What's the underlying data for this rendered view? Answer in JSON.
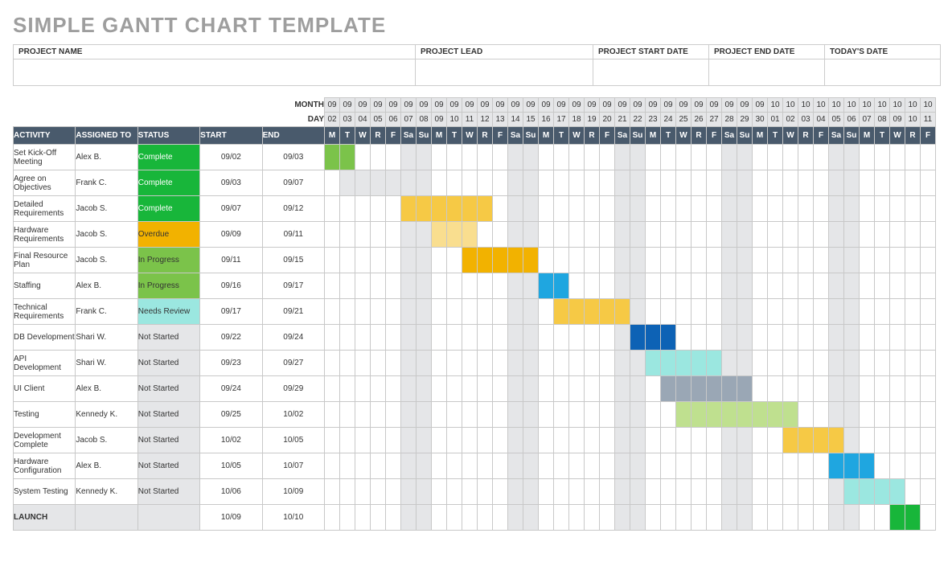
{
  "title": "SIMPLE GANTT CHART TEMPLATE",
  "meta": {
    "projectName": {
      "label": "PROJECT NAME",
      "value": ""
    },
    "projectLead": {
      "label": "PROJECT LEAD",
      "value": ""
    },
    "startDate": {
      "label": "PROJECT START DATE",
      "value": ""
    },
    "endDate": {
      "label": "PROJECT END DATE",
      "value": ""
    },
    "todaysDate": {
      "label": "TODAY'S DATE",
      "value": ""
    }
  },
  "rowLabels": {
    "month": "MONTH",
    "day": "DAY"
  },
  "columnHeaders": {
    "activity": "ACTIVITY",
    "assigned": "ASSIGNED TO",
    "status": "STATUS",
    "start": "START",
    "end": "END"
  },
  "calendar": {
    "months": [
      "09",
      "09",
      "09",
      "09",
      "09",
      "09",
      "09",
      "09",
      "09",
      "09",
      "09",
      "09",
      "09",
      "09",
      "09",
      "09",
      "09",
      "09",
      "09",
      "09",
      "09",
      "09",
      "09",
      "09",
      "09",
      "09",
      "09",
      "09",
      "09",
      "10",
      "10",
      "10",
      "10",
      "10",
      "10",
      "10",
      "10",
      "10",
      "10",
      "10"
    ],
    "days": [
      "02",
      "03",
      "04",
      "05",
      "06",
      "07",
      "08",
      "09",
      "10",
      "11",
      "12",
      "13",
      "14",
      "15",
      "16",
      "17",
      "18",
      "19",
      "20",
      "21",
      "22",
      "23",
      "24",
      "25",
      "26",
      "27",
      "28",
      "29",
      "30",
      "01",
      "02",
      "03",
      "04",
      "05",
      "06",
      "07",
      "08",
      "09",
      "10",
      "11"
    ],
    "dow": [
      "M",
      "T",
      "W",
      "R",
      "F",
      "Sa",
      "Su",
      "M",
      "T",
      "W",
      "R",
      "F",
      "Sa",
      "Su",
      "M",
      "T",
      "W",
      "R",
      "F",
      "Sa",
      "Su",
      "M",
      "T",
      "W",
      "R",
      "F",
      "Sa",
      "Su",
      "M",
      "T",
      "W",
      "R",
      "F",
      "Sa",
      "Su",
      "M",
      "T",
      "W",
      "R",
      "F"
    ]
  },
  "statusColors": {
    "Complete": "#18b63a",
    "Overdue": "#f2b200",
    "In Progress": "#7bc34a",
    "Needs Review": "#9be7e0",
    "Not Started": "#e5e6e8",
    "Launch": "#18b63a"
  },
  "chart_data": {
    "type": "gantt",
    "title": "SIMPLE GANTT CHART TEMPLATE",
    "date_range_start": "09/02",
    "date_range_end": "10/11",
    "tasks": [
      {
        "activity": "Set Kick-Off Meeting",
        "assigned": "Alex B.",
        "status": "Complete",
        "start": "09/02",
        "end": "09/03",
        "startIdx": 0,
        "endIdx": 1,
        "barColor": "#7bc34a"
      },
      {
        "activity": "Agree on Objectives",
        "assigned": "Frank C.",
        "status": "Complete",
        "start": "09/03",
        "end": "09/07",
        "startIdx": 1,
        "endIdx": 5,
        "barColor": "#e5e6e8"
      },
      {
        "activity": "Detailed Requirements",
        "assigned": "Jacob S.",
        "status": "Complete",
        "start": "09/07",
        "end": "09/12",
        "startIdx": 5,
        "endIdx": 10,
        "barColor": "#f6c945"
      },
      {
        "activity": "Hardware Requirements",
        "assigned": "Jacob S.",
        "status": "Overdue",
        "start": "09/09",
        "end": "09/11",
        "startIdx": 7,
        "endIdx": 9,
        "barColor": "#f9de8f"
      },
      {
        "activity": "Final Resource Plan",
        "assigned": "Jacob S.",
        "status": "In Progress",
        "start": "09/11",
        "end": "09/15",
        "startIdx": 9,
        "endIdx": 13,
        "barColor": "#f2b200"
      },
      {
        "activity": "Staffing",
        "assigned": "Alex B.",
        "status": "In Progress",
        "start": "09/16",
        "end": "09/17",
        "startIdx": 14,
        "endIdx": 15,
        "barColor": "#1fa6e0"
      },
      {
        "activity": "Technical Requirements",
        "assigned": "Frank C.",
        "status": "Needs Review",
        "start": "09/17",
        "end": "09/21",
        "startIdx": 15,
        "endIdx": 19,
        "barColor": "#f6c945"
      },
      {
        "activity": "DB Development",
        "assigned": "Shari W.",
        "status": "Not Started",
        "start": "09/22",
        "end": "09/24",
        "startIdx": 20,
        "endIdx": 22,
        "barColor": "#0d62b5"
      },
      {
        "activity": "API Development",
        "assigned": "Shari W.",
        "status": "Not Started",
        "start": "09/23",
        "end": "09/27",
        "startIdx": 21,
        "endIdx": 25,
        "barColor": "#9be7e0"
      },
      {
        "activity": "UI Client",
        "assigned": "Alex B.",
        "status": "Not Started",
        "start": "09/24",
        "end": "09/29",
        "startIdx": 22,
        "endIdx": 27,
        "barColor": "#9aa7b5"
      },
      {
        "activity": "Testing",
        "assigned": "Kennedy K.",
        "status": "Not Started",
        "start": "09/25",
        "end": "10/02",
        "startIdx": 23,
        "endIdx": 30,
        "barColor": "#bfe08f"
      },
      {
        "activity": "Development Complete",
        "assigned": "Jacob S.",
        "status": "Not Started",
        "start": "10/02",
        "end": "10/05",
        "startIdx": 30,
        "endIdx": 33,
        "barColor": "#f6c945"
      },
      {
        "activity": "Hardware Configuration",
        "assigned": "Alex B.",
        "status": "Not Started",
        "start": "10/05",
        "end": "10/07",
        "startIdx": 33,
        "endIdx": 35,
        "barColor": "#1fa6e0"
      },
      {
        "activity": "System Testing",
        "assigned": "Kennedy K.",
        "status": "Not Started",
        "start": "10/06",
        "end": "10/09",
        "startIdx": 34,
        "endIdx": 37,
        "barColor": "#9be7e0"
      },
      {
        "activity": "LAUNCH",
        "assigned": "",
        "status": "",
        "start": "10/09",
        "end": "10/10",
        "startIdx": 37,
        "endIdx": 38,
        "barColor": "#18b63a",
        "isLaunch": true
      }
    ]
  }
}
